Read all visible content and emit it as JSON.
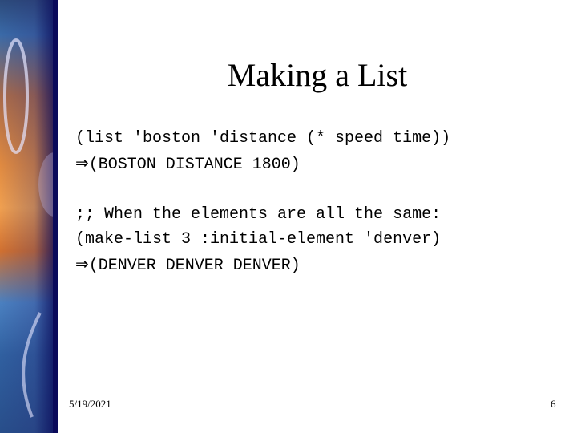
{
  "slide": {
    "title": "Making a List",
    "lines": [
      {
        "arrow": "",
        "text": "(list 'boston 'distance (* speed time))"
      },
      {
        "arrow": "⇒",
        "text": "(BOSTON DISTANCE 1800)"
      },
      {
        "arrow": "",
        "text": ";; When the elements are all the same:"
      },
      {
        "arrow": "",
        "text": "(make-list 3 :initial-element 'denver)"
      },
      {
        "arrow": "⇒",
        "text": "(DENVER DENVER DENVER)"
      }
    ],
    "footer_date": "5/19/2021",
    "page_number": "6"
  }
}
